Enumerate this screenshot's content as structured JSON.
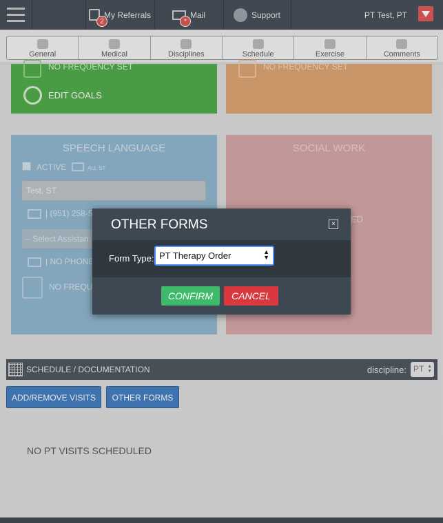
{
  "topbar": {
    "referrals_label": "My Referrals",
    "referrals_badge": "2",
    "mail_label": "Mail",
    "mail_badge": "*",
    "support_label": "Support",
    "user_name": "PT Test, PT"
  },
  "tabs": [
    {
      "label": "General"
    },
    {
      "label": "Medical"
    },
    {
      "label": "Disciplines"
    },
    {
      "label": "Schedule"
    },
    {
      "label": "Exercise"
    },
    {
      "label": "Comments"
    }
  ],
  "panels": {
    "green": {
      "frequency_text": "NO FREQUENCY SET",
      "edit_goals": "EDIT GOALS"
    },
    "orange": {
      "frequency_text": "NO FREQUENCY SET"
    },
    "speech": {
      "title": "SPEECH LANGUAGE",
      "active_label": "ACTIVE",
      "all_st_label": "ALL ST",
      "therapist_value": "Test, ST",
      "phone_text": "| (951) 258-5",
      "assistant_placeholder": "-- Select Assistan",
      "no_phone_text": "| NO PHONE",
      "frequency_text": "NO FREQUE"
    },
    "social": {
      "title": "SOCIAL WORK",
      "partial_text": "ED"
    }
  },
  "modal": {
    "title": "OTHER FORMS",
    "close_symbol": "×",
    "form_type_label": "Form Type:",
    "form_type_value": "PT Therapy Order",
    "confirm_label": "CONFIRM",
    "cancel_label": "CANCEL"
  },
  "schedule": {
    "title": "SCHEDULE / DOCUMENTATION",
    "discipline_label": "discipline:",
    "discipline_value": "PT",
    "add_remove_label": "ADD/REMOVE VISITS",
    "other_forms_label": "OTHER FORMS",
    "empty_text": "NO PT VISITS SCHEDULED"
  },
  "colors": {
    "green_panel": "#4caa45",
    "orange_panel": "#dca26f",
    "blue_panel": "#8fb6cf",
    "pink_panel": "#d5a4a4",
    "confirm": "#3fb96a",
    "cancel": "#d9393e",
    "primary_button": "#3f7cc1"
  }
}
